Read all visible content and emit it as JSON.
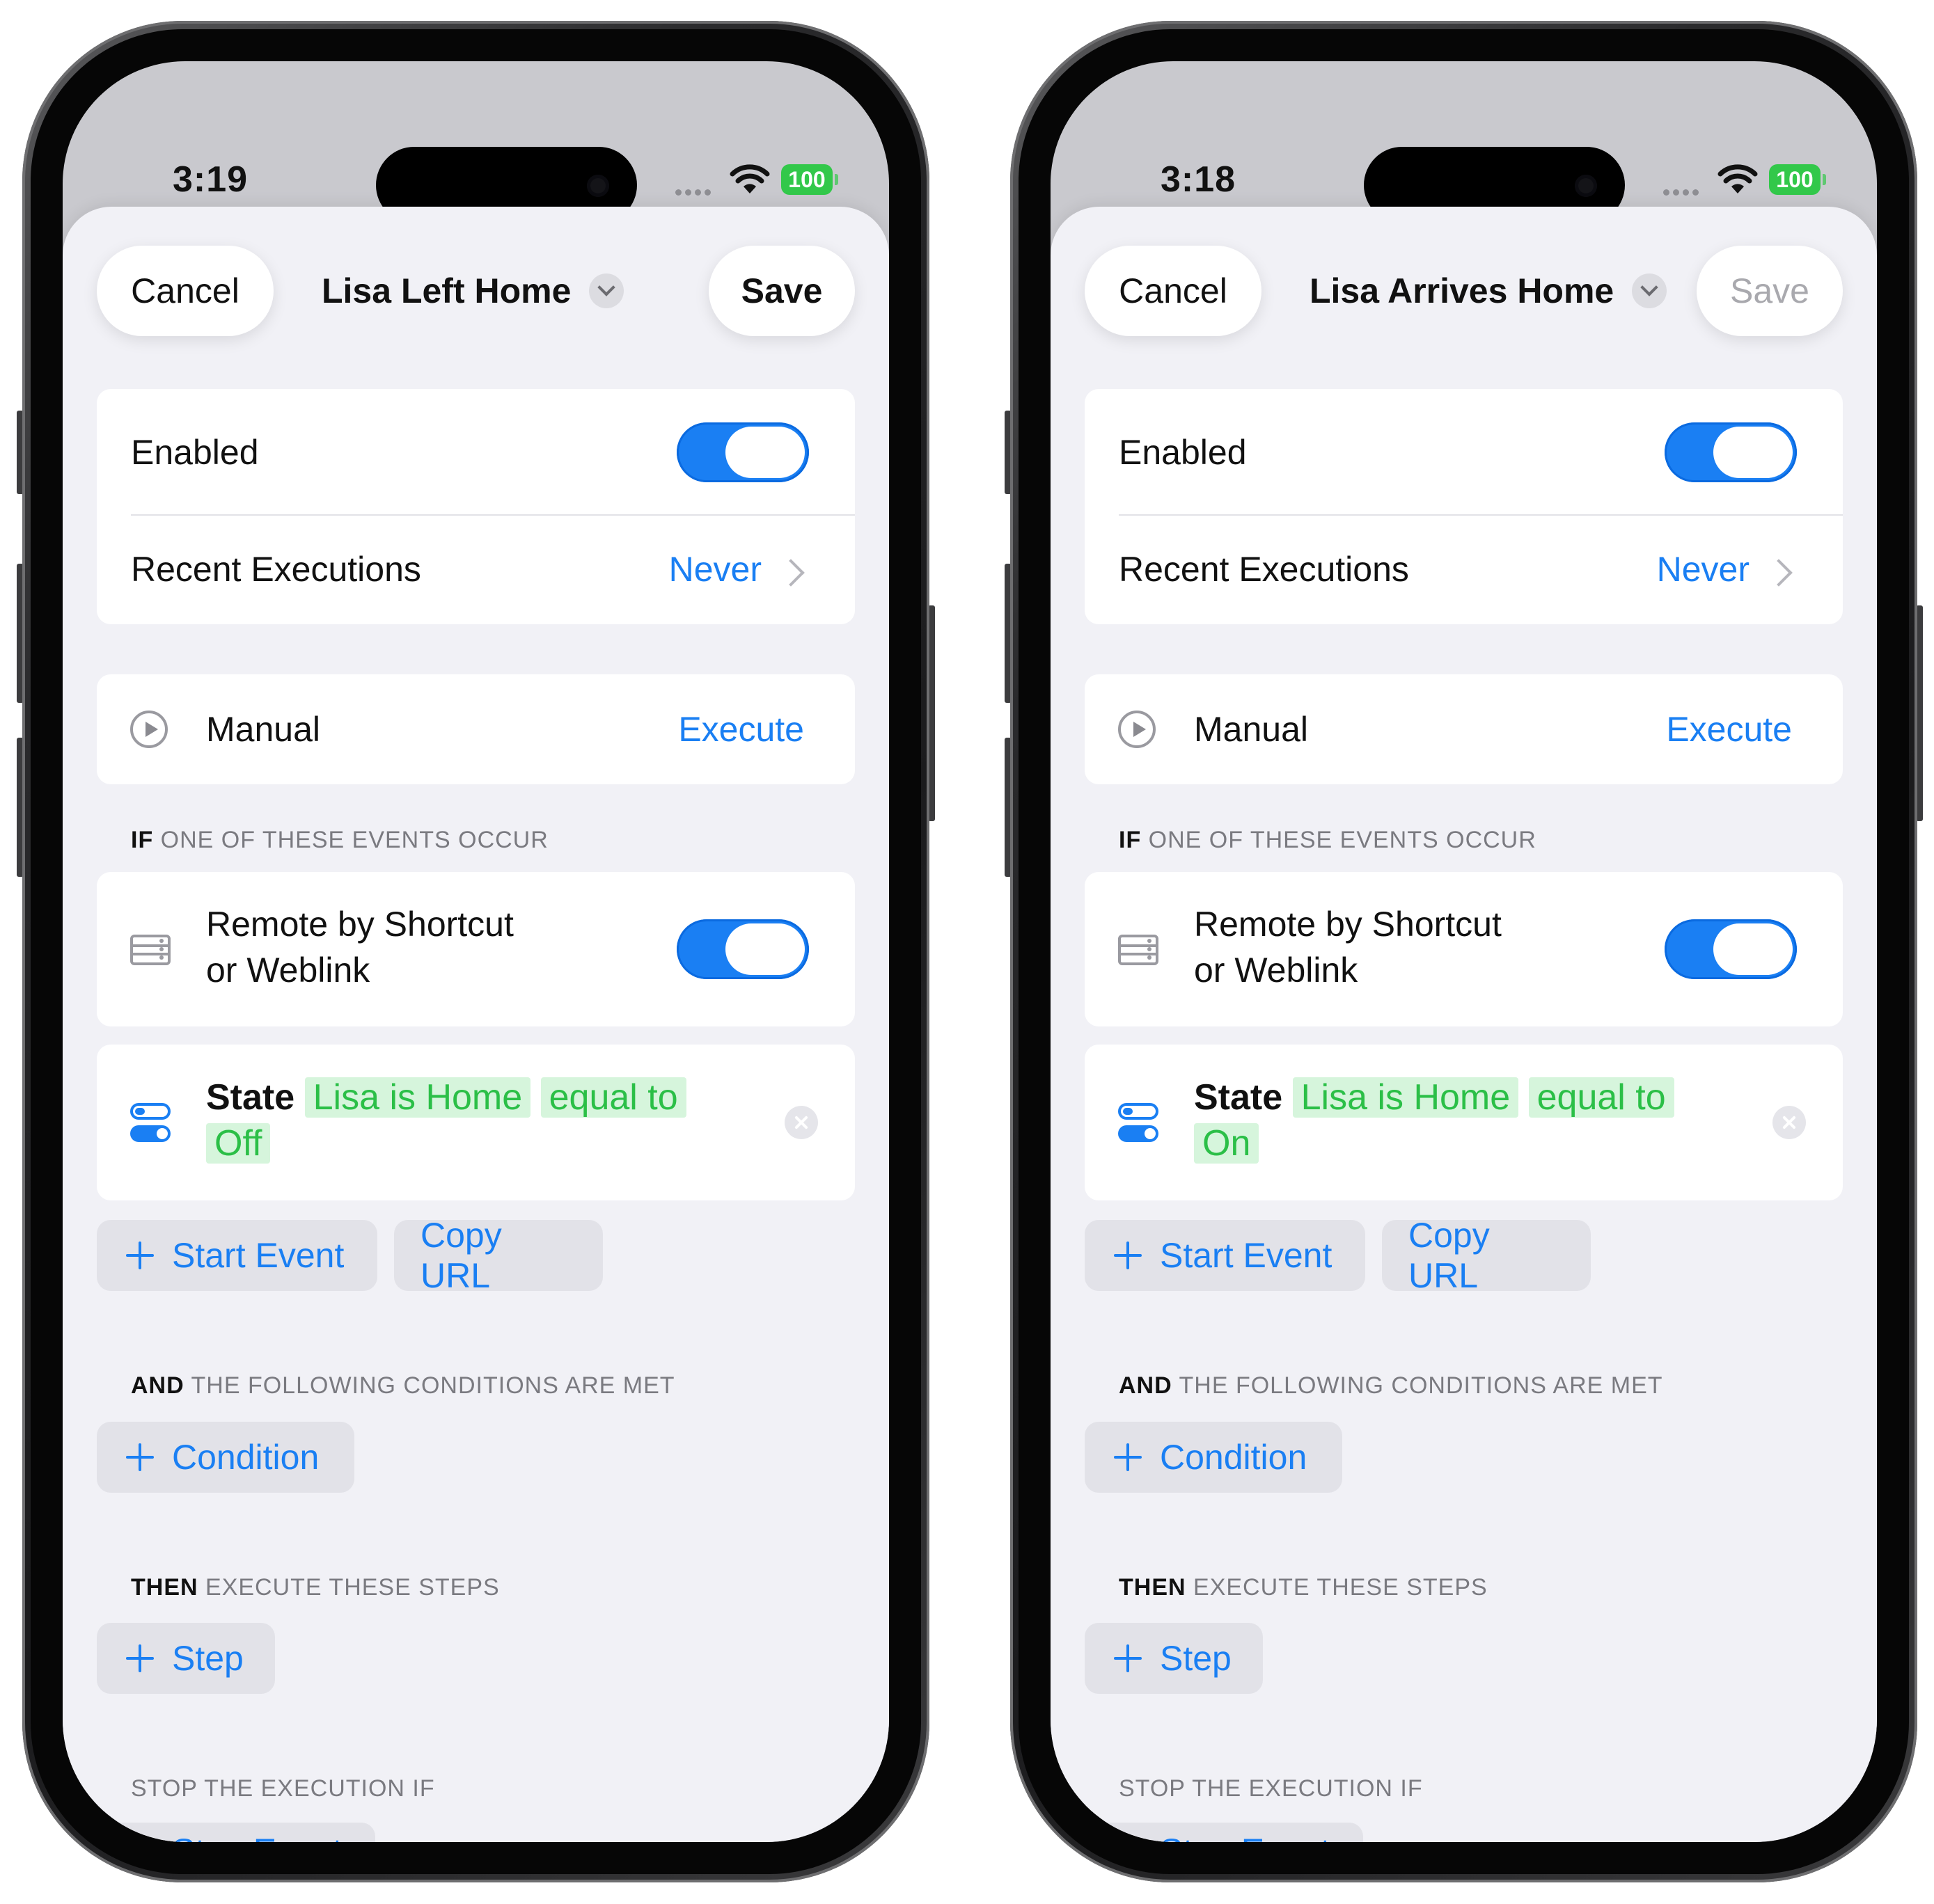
{
  "phones": [
    {
      "status": {
        "time": "3:19",
        "battery": "100"
      },
      "nav": {
        "cancel": "Cancel",
        "title": "Lisa Left Home",
        "save": "Save",
        "save_enabled": true
      },
      "enabled_label": "Enabled",
      "enabled_on": true,
      "recent_label": "Recent Executions",
      "recent_value": "Never",
      "manual_label": "Manual",
      "execute_label": "Execute",
      "if_header": {
        "keyword": "IF",
        "rest": "ONE OF THESE EVENTS OCCUR"
      },
      "remote_label_1": "Remote by Shortcut",
      "remote_label_2": "or Weblink",
      "remote_on": true,
      "state": {
        "label": "State",
        "entity": "Lisa is Home",
        "op": "equal to",
        "value": "Off"
      },
      "start_event": "Start Event",
      "copy_url": "Copy URL",
      "and_header": {
        "keyword": "AND",
        "rest": "THE FOLLOWING CONDITIONS ARE MET"
      },
      "condition": "Condition",
      "then_header": {
        "keyword": "THEN",
        "rest": "EXECUTE THESE STEPS"
      },
      "step": "Step",
      "stop_header": "STOP THE EXECUTION IF",
      "stop_event": "Stop Event"
    },
    {
      "status": {
        "time": "3:18",
        "battery": "100"
      },
      "nav": {
        "cancel": "Cancel",
        "title": "Lisa Arrives Home",
        "save": "Save",
        "save_enabled": false
      },
      "enabled_label": "Enabled",
      "enabled_on": true,
      "recent_label": "Recent Executions",
      "recent_value": "Never",
      "manual_label": "Manual",
      "execute_label": "Execute",
      "if_header": {
        "keyword": "IF",
        "rest": "ONE OF THESE EVENTS OCCUR"
      },
      "remote_label_1": "Remote by Shortcut",
      "remote_label_2": "or Weblink",
      "remote_on": true,
      "state": {
        "label": "State",
        "entity": "Lisa is Home",
        "op": "equal to",
        "value": "On"
      },
      "start_event": "Start Event",
      "copy_url": "Copy URL",
      "and_header": {
        "keyword": "AND",
        "rest": "THE FOLLOWING CONDITIONS ARE MET"
      },
      "condition": "Condition",
      "then_header": {
        "keyword": "THEN",
        "rest": "EXECUTE THESE STEPS"
      },
      "step": "Step",
      "stop_header": "STOP THE EXECUTION IF",
      "stop_event": "Stop Event"
    }
  ],
  "colors": {
    "accent": "#1a7ff3",
    "token_text": "#2bbf47",
    "token_bg": "#d6f5dc",
    "battery": "#32c84a",
    "disabled_text": "#a9a9ae"
  }
}
